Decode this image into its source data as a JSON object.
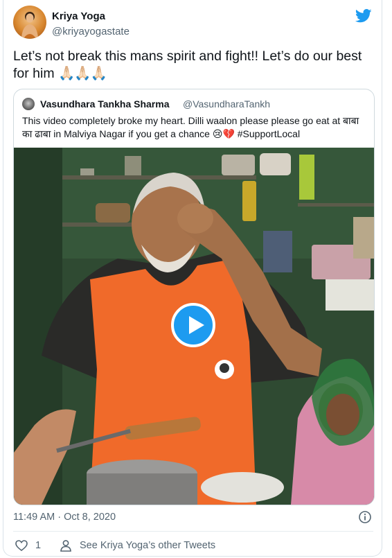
{
  "author": {
    "name": "Kriya Yoga",
    "handle": "@kriyayogastate"
  },
  "tweet": {
    "text": "Let’s not break this mans spirit and fight!!  Let’s do our best for him",
    "emoji": "🙏🏻🙏🏻🙏🏻"
  },
  "quoted": {
    "name": "Vasundhara Tankha Sharma",
    "handle": "@VasundharaTankh",
    "text": "This video completely broke my heart. Dilli waalon please please go eat at बाबा का ढाबा in Malviya Nagar if you get a chance 😢💔 #SupportLocal"
  },
  "meta": {
    "timestamp": "11:49 AM · Oct 8, 2020",
    "like_count": "1",
    "see_more": "See Kriya Yoga’s other Tweets"
  },
  "colors": {
    "brand": "#1d9bf0",
    "secondary_text": "#536471",
    "vest": "#f06a2a"
  },
  "icons": {
    "brand": "twitter-bird-icon",
    "info": "info-icon",
    "like": "heart-icon",
    "profile": "person-icon",
    "play": "play-icon"
  }
}
